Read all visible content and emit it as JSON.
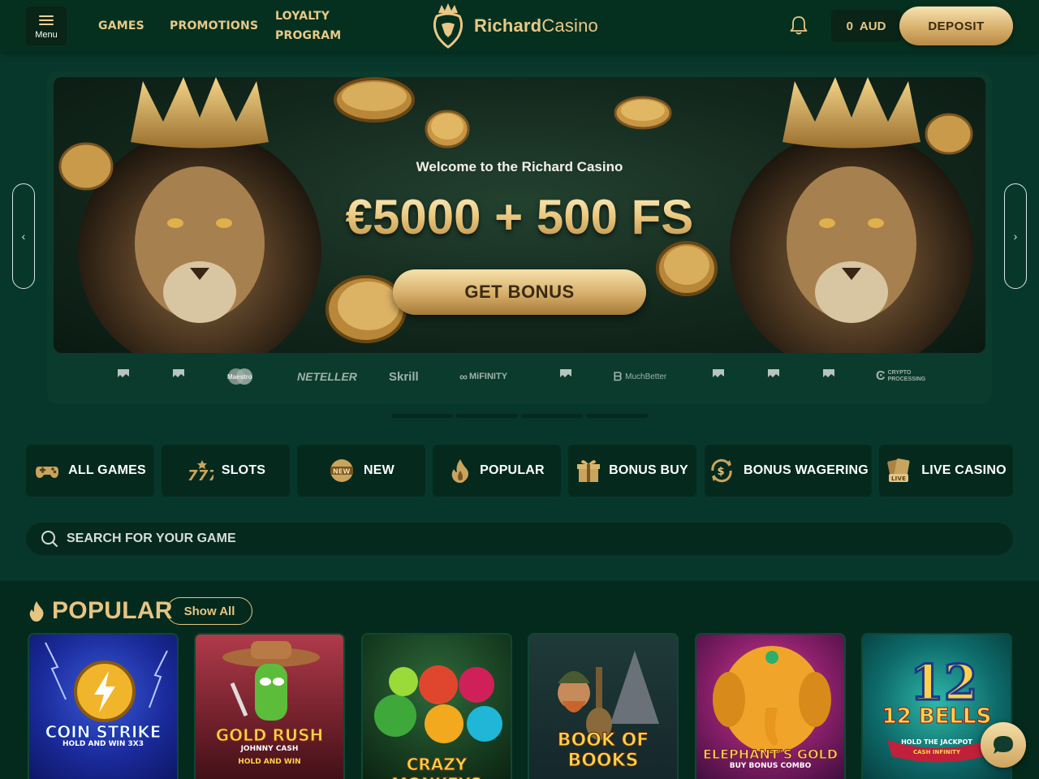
{
  "header": {
    "menu_label": "Menu",
    "nav": {
      "games": "GAMES",
      "promotions": "PROMOTIONS",
      "loyalty_line1": "LOYALTY",
      "loyalty_line2": "PROGRAM"
    },
    "logo_bold": "Richard",
    "logo_light": "Casino",
    "balance_amount": "0",
    "balance_currency": "AUD",
    "deposit_label": "DEPOSIT"
  },
  "hero": {
    "welcome": "Welcome to the Richard Casino",
    "headline": "€5000 + 500 FS",
    "cta": "GET BONUS",
    "prev_arrow": "‹",
    "next_arrow": "›",
    "payments": [
      "Maestro",
      "NETELLER",
      "Skrill",
      "MiFINITY",
      "MuchBetter",
      "CRYPTO PROCESSING"
    ]
  },
  "tabs": [
    {
      "label": "ALL GAMES",
      "icon": "gamepad-icon"
    },
    {
      "label": "SLOTS",
      "icon": "slots-777-icon"
    },
    {
      "label": "NEW",
      "icon": "new-badge-icon"
    },
    {
      "label": "POPULAR",
      "icon": "fire-icon"
    },
    {
      "label": "BONUS BUY",
      "icon": "gift-icon"
    },
    {
      "label": "BONUS WAGERING",
      "icon": "dollar-refresh-icon"
    },
    {
      "label": "LIVE CASINO",
      "icon": "live-cards-icon"
    }
  ],
  "search": {
    "placeholder": "SEARCH FOR YOUR GAME"
  },
  "popular": {
    "title": "POPULAR",
    "show_all": "Show All",
    "games": [
      {
        "name": "COIN STRIKE",
        "sub": "HOLD AND WIN 3X3"
      },
      {
        "name": "GOLD RUSH",
        "sub": "JOHNNY CASH",
        "sub2": "HOLD AND WIN"
      },
      {
        "name": "CRAZY MONKEYS"
      },
      {
        "name": "BOOK OF BOOKS"
      },
      {
        "name": "ELEPHANT'S GOLD",
        "sub": "BUY BONUS COMBO"
      },
      {
        "name": "12 BELLS",
        "sub": "HOLD THE JACKPOT",
        "sub2": "CASH INFINITY"
      }
    ]
  },
  "colors": {
    "background": "#07372a",
    "gold": "#e6c583",
    "header": "#05301f",
    "tab_bg": "#052a1d"
  }
}
